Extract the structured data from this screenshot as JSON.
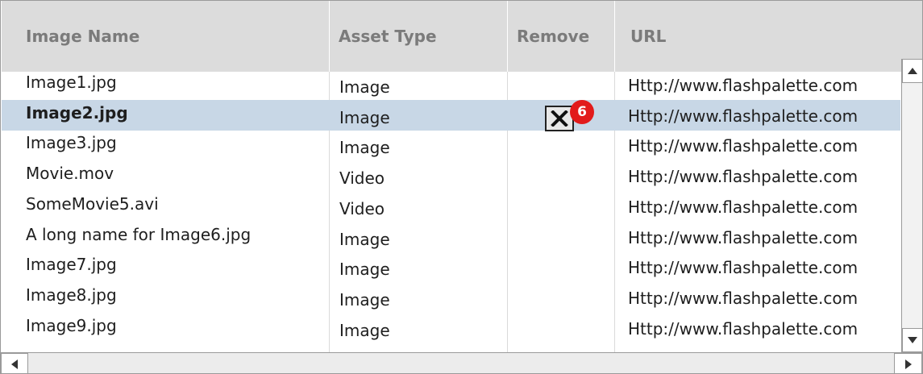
{
  "columns": [
    {
      "label": "Image Name"
    },
    {
      "label": "Asset Type"
    },
    {
      "label": "Remove"
    },
    {
      "label": "URL"
    }
  ],
  "rows": [
    {
      "name": "Image1.jpg",
      "type": "Image",
      "url": "Http://www.flashpalette.com"
    },
    {
      "name": "Image2.jpg",
      "type": "Image",
      "url": "Http://www.flashpalette.com"
    },
    {
      "name": "Image3.jpg",
      "type": "Image",
      "url": "Http://www.flashpalette.com"
    },
    {
      "name": "Movie.mov",
      "type": "Video",
      "url": "Http://www.flashpalette.com"
    },
    {
      "name": "SomeMovie5.avi",
      "type": "Video",
      "url": "Http://www.flashpalette.com"
    },
    {
      "name": "A long name for Image6.jpg",
      "type": "Image",
      "url": "Http://www.flashpalette.com"
    },
    {
      "name": "Image7.jpg",
      "type": "Image",
      "url": "Http://www.flashpalette.com"
    },
    {
      "name": "Image8.jpg",
      "type": "Image",
      "url": "Http://www.flashpalette.com"
    },
    {
      "name": "Image9.jpg",
      "type": "Image",
      "url": "Http://www.flashpalette.com"
    }
  ],
  "selected_row": 2,
  "remove_badge": "6",
  "icons": {
    "remove": "close-x-icon",
    "scroll_up": "arrow-up-icon",
    "scroll_down": "arrow-down-icon",
    "scroll_left": "arrow-left-icon",
    "scroll_right": "arrow-right-icon"
  },
  "colors": {
    "header_bg": "#dcdcdc",
    "header_text": "#7b7b7b",
    "selected_row": "#c8d7e6",
    "badge": "#e21b1b"
  }
}
